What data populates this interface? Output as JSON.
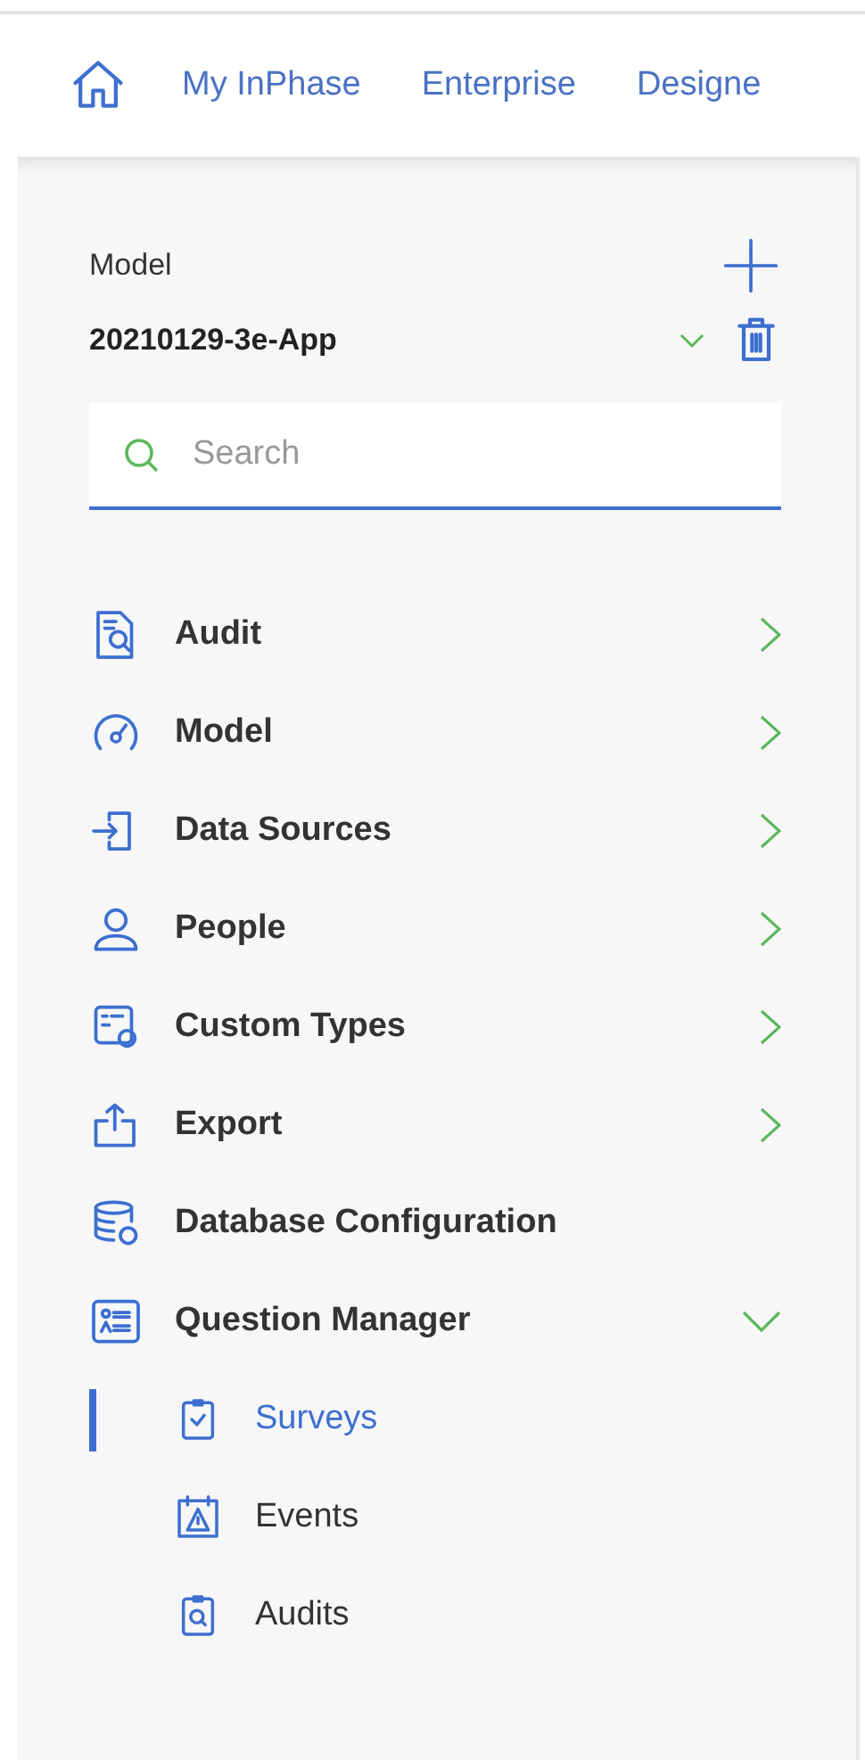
{
  "nav": {
    "links": [
      {
        "label": "My InPhase"
      },
      {
        "label": "Enterprise"
      },
      {
        "label": "Designe"
      }
    ]
  },
  "model": {
    "label": "Model",
    "value": "20210129-3e-App"
  },
  "search": {
    "placeholder": "Search"
  },
  "menu": [
    {
      "label": "Audit",
      "expanded": false
    },
    {
      "label": "Model",
      "expanded": false
    },
    {
      "label": "Data Sources",
      "expanded": false
    },
    {
      "label": "People",
      "expanded": false
    },
    {
      "label": "Custom Types",
      "expanded": false
    },
    {
      "label": "Export",
      "expanded": false
    },
    {
      "label": "Database Configuration"
    },
    {
      "label": "Question Manager",
      "expanded": true,
      "children": [
        {
          "label": "Surveys",
          "selected": true
        },
        {
          "label": "Events",
          "selected": false
        },
        {
          "label": "Audits",
          "selected": false
        }
      ]
    }
  ]
}
